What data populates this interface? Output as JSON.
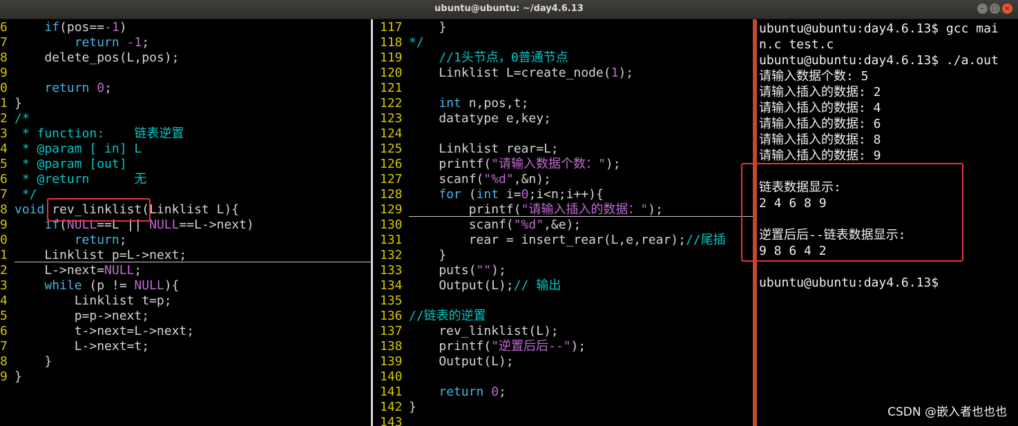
{
  "window": {
    "title": "ubuntu@ubuntu: ~/day4.6.13"
  },
  "left_pane": {
    "lines": [
      {
        "n": "6",
        "t": "    if(pos==-1)"
      },
      {
        "n": "7",
        "t": "        return -1;"
      },
      {
        "n": "8",
        "t": "    delete_pos(L,pos);"
      },
      {
        "n": "9",
        "t": ""
      },
      {
        "n": "0",
        "t": "    return 0;"
      },
      {
        "n": "1",
        "t": "}"
      },
      {
        "n": "2",
        "t": "/*"
      },
      {
        "n": "3",
        "t": " * function:    链表逆置"
      },
      {
        "n": "4",
        "t": " * @param [ in] L"
      },
      {
        "n": "5",
        "t": " * @param [out]"
      },
      {
        "n": "6",
        "t": " * @return      无"
      },
      {
        "n": "7",
        "t": " */"
      },
      {
        "n": "8",
        "t": "void rev_linklist(Linklist L){"
      },
      {
        "n": "9",
        "t": "    if(NULL==L || NULL==L->next)"
      },
      {
        "n": "0",
        "t": "        return;"
      },
      {
        "n": "1",
        "t": "    Linklist p=L->next;"
      },
      {
        "n": "2",
        "t": "    L->next=NULL;"
      },
      {
        "n": "3",
        "t": "    while (p != NULL){"
      },
      {
        "n": "4",
        "t": "        Linklist t=p;"
      },
      {
        "n": "5",
        "t": "        p=p->next;"
      },
      {
        "n": "6",
        "t": "        t->next=L->next;"
      },
      {
        "n": "7",
        "t": "        L->next=t;"
      },
      {
        "n": "8",
        "t": "    }"
      },
      {
        "n": "9",
        "t": "}"
      }
    ]
  },
  "mid_pane": {
    "lines": [
      {
        "n": "117",
        "t": "    }"
      },
      {
        "n": "118",
        "t": "*/"
      },
      {
        "n": "119",
        "t": "    //1头节点，0普通节点"
      },
      {
        "n": "120",
        "t": "    Linklist L=create_node(1);"
      },
      {
        "n": "121",
        "t": ""
      },
      {
        "n": "122",
        "t": "    int n,pos,t;"
      },
      {
        "n": "123",
        "t": "    datatype e,key;"
      },
      {
        "n": "124",
        "t": ""
      },
      {
        "n": "125",
        "t": "    Linklist rear=L;"
      },
      {
        "n": "126",
        "t": "    printf(\"请输入数据个数：\");"
      },
      {
        "n": "127",
        "t": "    scanf(\"%d\",&n);"
      },
      {
        "n": "128",
        "t": "    for (int i=0;i<n;i++){"
      },
      {
        "n": "129",
        "t": "        printf(\"请输入插入的数据：\");"
      },
      {
        "n": "130",
        "t": "        scanf(\"%d\",&e);"
      },
      {
        "n": "131",
        "t": "        rear = insert_rear(L,e,rear);//尾插"
      },
      {
        "n": "132",
        "t": "    }"
      },
      {
        "n": "133",
        "t": "    puts(\"\");"
      },
      {
        "n": "134",
        "t": "    Output(L);// 输出"
      },
      {
        "n": "135",
        "t": ""
      },
      {
        "n": "136",
        "t": "//链表的逆置"
      },
      {
        "n": "137",
        "t": "    rev_linklist(L);"
      },
      {
        "n": "138",
        "t": "    printf(\"逆置后后--\");"
      },
      {
        "n": "139",
        "t": "    Output(L);"
      },
      {
        "n": "140",
        "t": ""
      },
      {
        "n": "141",
        "t": "    return 0;"
      },
      {
        "n": "142",
        "t": "}"
      },
      {
        "n": "143",
        "t": ""
      }
    ]
  },
  "terminal": {
    "lines": [
      "ubuntu@ubuntu:day4.6.13$ gcc mai",
      "n.c test.c",
      "ubuntu@ubuntu:day4.6.13$ ./a.out",
      "请输入数据个数: 5",
      "请输入插入的数据: 2",
      "请输入插入的数据: 4",
      "请输入插入的数据: 6",
      "请输入插入的数据: 8",
      "请输入插入的数据: 9",
      "",
      "链表数据显示:",
      "2 4 6 8 9",
      "",
      "逆置后后--链表数据显示:",
      "9 8 6 4 2",
      "",
      "ubuntu@ubuntu:day4.6.13$"
    ]
  },
  "watermark": "CSDN @嵌入者也也也",
  "colors": {
    "line_number": "#d6c700",
    "keyword": "#44b6e6",
    "comment": "#00c8c8",
    "string": "#c06bd0",
    "highlight_box": "#e8323e"
  }
}
